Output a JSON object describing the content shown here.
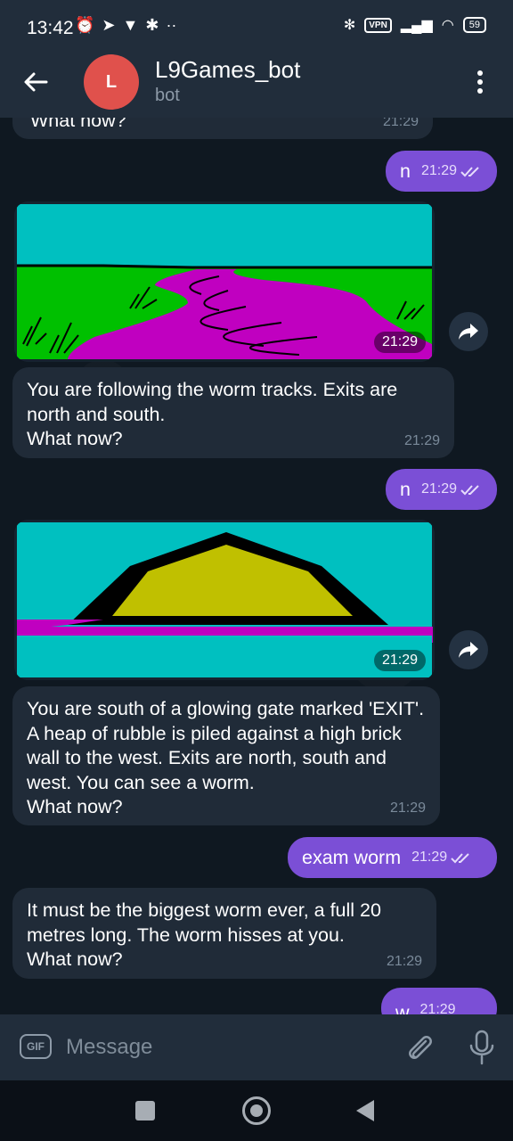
{
  "status_bar": {
    "time": "13:42",
    "left_icons": [
      "alarm-icon",
      "telegram-icon",
      "location-icon",
      "bug-icon",
      "more-dots-icon"
    ],
    "vpn": "VPN",
    "battery": "59"
  },
  "header": {
    "avatar_letter": "L",
    "title": "L9Games_bot",
    "subtitle": "bot"
  },
  "messages": {
    "m0": {
      "text": "What now?",
      "time": "21:29"
    },
    "m1": {
      "text": "n",
      "time": "21:29"
    },
    "p1": {
      "time": "21:29"
    },
    "m2": {
      "text": "You are following the worm tracks. Exits are north and south.\nWhat now?",
      "time": "21:29"
    },
    "m3": {
      "text": "n",
      "time": "21:29"
    },
    "p2": {
      "time": "21:29"
    },
    "m4": {
      "text": "You are south of a glowing gate marked 'EXIT'. A heap of rubble is piled against a high brick wall to the west. Exits are north, south and west. You can see a worm.\nWhat now?",
      "time": "21:29"
    },
    "m5": {
      "text": "exam worm",
      "time": "21:29"
    },
    "m6": {
      "text": "It must be the biggest worm ever, a full 20 metres long. The worm hisses at you.\nWhat now?",
      "time": "21:29"
    },
    "m7": {
      "text": "w",
      "time": "21:29"
    }
  },
  "input": {
    "gif_label": "GIF",
    "placeholder": "Message"
  },
  "colors": {
    "outgoing_bubble": "#7b4fd6",
    "incoming_bubble": "#202b38",
    "header": "#212d3b",
    "avatar": "#e0514c"
  }
}
